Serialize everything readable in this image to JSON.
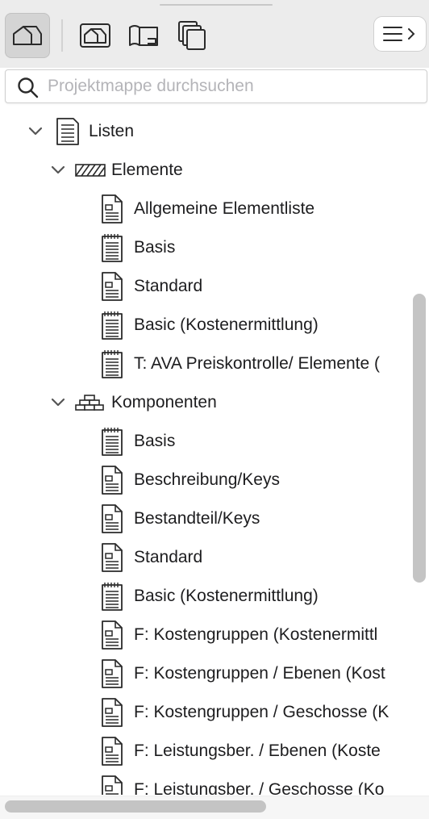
{
  "toolbar": {
    "buttons": [
      {
        "icon": "house-icon",
        "active": true
      },
      {
        "icon": "view-map-icon",
        "active": false
      },
      {
        "icon": "layout-book-icon",
        "active": false
      },
      {
        "icon": "publisher-sets-icon",
        "active": false
      }
    ],
    "menu_icon": "hamburger-chevron-icon"
  },
  "search": {
    "placeholder": "Projektmappe durchsuchen",
    "value": ""
  },
  "tree": {
    "root": {
      "label": "Listen",
      "expanded": true,
      "groups": [
        {
          "label": "Elemente",
          "icon": "hatch-wall-icon",
          "expanded": true,
          "items": [
            {
              "label": "Allgemeine Elementliste",
              "icon": "document-icon"
            },
            {
              "label": "Basis",
              "icon": "schedule-icon"
            },
            {
              "label": "Standard",
              "icon": "document-icon"
            },
            {
              "label": "Basic (Kostenermittlung)",
              "icon": "schedule-icon"
            },
            {
              "label": "T: AVA Preiskontrolle/ Elemente (",
              "icon": "schedule-icon"
            }
          ]
        },
        {
          "label": "Komponenten",
          "icon": "brick-stack-icon",
          "expanded": true,
          "items": [
            {
              "label": "Basis",
              "icon": "schedule-icon"
            },
            {
              "label": "Beschreibung/Keys",
              "icon": "document-icon"
            },
            {
              "label": "Bestandteil/Keys",
              "icon": "document-icon"
            },
            {
              "label": "Standard",
              "icon": "document-icon"
            },
            {
              "label": "Basic (Kostenermittlung)",
              "icon": "schedule-icon"
            },
            {
              "label": "F: Kostengruppen (Kostenermittl",
              "icon": "document-icon"
            },
            {
              "label": "F: Kostengruppen / Ebenen (Kost",
              "icon": "document-icon"
            },
            {
              "label": "F: Kostengruppen / Geschosse (K",
              "icon": "document-icon"
            },
            {
              "label": "F: Leistungsber. / Ebenen (Koste",
              "icon": "document-icon"
            },
            {
              "label": "F: Leistungsber. / Geschosse (Ko",
              "icon": "document-icon"
            }
          ]
        }
      ]
    }
  },
  "colors": {
    "toolbar_bg": "#ececec",
    "text": "#1d1d1f",
    "placeholder": "#b4b4b8",
    "scrollbar": "#c4c4c4"
  }
}
